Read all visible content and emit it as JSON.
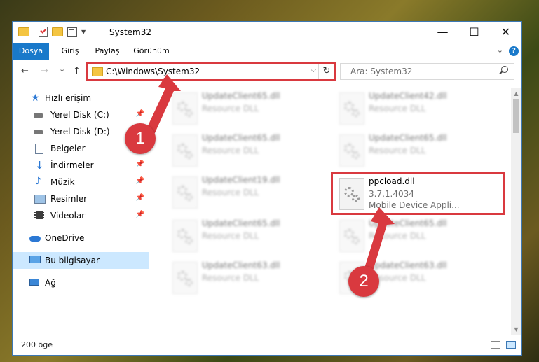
{
  "window": {
    "title": "System32",
    "controls": {
      "minimize": "—",
      "maximize": "☐",
      "close": "✕"
    }
  },
  "ribbon": {
    "tabs": [
      "Dosya",
      "Giriş",
      "Paylaş",
      "Görünüm"
    ],
    "expand_icon": "chevron-down-icon",
    "help_label": "?"
  },
  "navigation": {
    "back": "←",
    "forward": "→",
    "recent": "⌄",
    "up": "↑",
    "address_path": "C:\\Windows\\System32",
    "dropdown": "⌵",
    "refresh": "↻",
    "search_placeholder": "Ara: System32"
  },
  "sidebar": {
    "items": [
      {
        "label": "Hızlı erişim",
        "icon": "star-icon"
      },
      {
        "label": "Yerel Disk (C:)",
        "icon": "drive-icon",
        "pinned": true
      },
      {
        "label": "Yerel Disk (D:)",
        "icon": "drive-icon",
        "pinned": true
      },
      {
        "label": "Belgeler",
        "icon": "documents-icon"
      },
      {
        "label": "İndirmeler",
        "icon": "download-icon",
        "pinned": true
      },
      {
        "label": "Müzik",
        "icon": "music-icon",
        "pinned": true
      },
      {
        "label": "Resimler",
        "icon": "pictures-icon",
        "pinned": true
      },
      {
        "label": "Videolar",
        "icon": "videos-icon",
        "pinned": true
      },
      {
        "label": "OneDrive",
        "icon": "cloud-icon"
      },
      {
        "label": "Bu bilgisayar",
        "icon": "computer-icon",
        "selected": true
      },
      {
        "label": "Ağ",
        "icon": "network-icon"
      }
    ],
    "pin_glyph": "📌"
  },
  "files": [
    {
      "name": "UpdateClient65.dll",
      "line1": "Resource DLL",
      "line2": "",
      "blurred": true
    },
    {
      "name": "UpdateClient42.dll",
      "line1": "Resource DLL",
      "line2": "",
      "blurred": true
    },
    {
      "name": "UpdateClient65.dll",
      "line1": "Resource DLL",
      "line2": "",
      "blurred": true
    },
    {
      "name": "UpdateClient65.dll",
      "line1": "Resource DLL",
      "line2": "",
      "blurred": true
    },
    {
      "name": "UpdateClient19.dll",
      "line1": "Resource DLL",
      "line2": "",
      "blurred": true
    },
    {
      "name": "ppcload.dll",
      "line1": "3.7.1.4034",
      "line2": "Mobile Device Appli...",
      "blurred": false
    },
    {
      "name": "UpdateClient65.dll",
      "line1": "Resource DLL",
      "line2": "",
      "blurred": true
    },
    {
      "name": "UpdateClient65.dll",
      "line1": "Resource DLL",
      "line2": "",
      "blurred": true
    },
    {
      "name": "UpdateClient63.dll",
      "line1": "Resource DLL",
      "line2": "",
      "blurred": true
    },
    {
      "name": "UpdateClient63.dll",
      "line1": "Resource DLL",
      "line2": "",
      "blurred": true
    }
  ],
  "status": {
    "item_count": "200 öge"
  },
  "annotations": {
    "step1": "1",
    "step2": "2",
    "highlight_color": "#d9393f"
  }
}
